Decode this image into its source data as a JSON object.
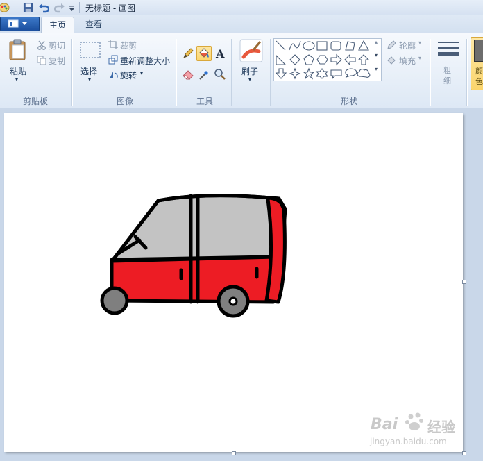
{
  "window": {
    "title": "无标题 - 画图"
  },
  "quick_access": {
    "icons": [
      "paint-app-icon",
      "save-icon",
      "undo-icon",
      "redo-icon",
      "customize-qat-icon"
    ]
  },
  "tabs": [
    {
      "label": "主页",
      "active": true
    },
    {
      "label": "查看",
      "active": false
    }
  ],
  "ribbon": {
    "clipboard": {
      "label": "剪贴板",
      "paste": "粘贴",
      "cut": "剪切",
      "copy": "复制"
    },
    "image": {
      "label": "图像",
      "select": "选择",
      "crop": "裁剪",
      "resize": "重新调整大小",
      "rotate": "旋转"
    },
    "tools": {
      "label": "工具",
      "selected": "fill"
    },
    "brushes": {
      "label": "刷子"
    },
    "shapes": {
      "label": "形状",
      "outline": "轮廓",
      "fill": "填充"
    },
    "size": {
      "label": "粗细"
    },
    "color1": {
      "label": "颜色"
    }
  },
  "canvas": {
    "drawing": "red-car",
    "colors": {
      "body": "#ed1c24",
      "windows": "#c3c3c3",
      "outline": "#000000",
      "wheels": "#7f7f7f"
    }
  },
  "watermark": {
    "brand": "Bai",
    "brand2": "经验",
    "url": "jingyan.baidu.com"
  }
}
